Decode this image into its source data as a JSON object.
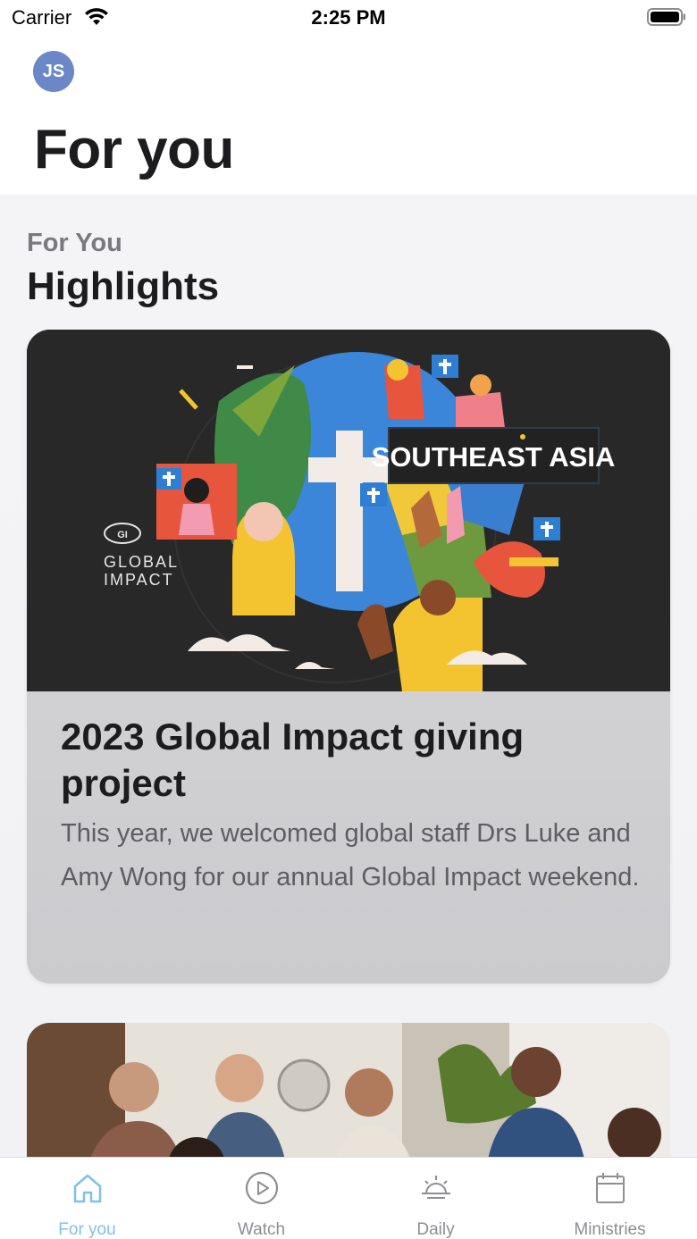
{
  "status_bar": {
    "carrier": "Carrier",
    "time": "2:25 PM",
    "wifi_icon": "wifi-icon",
    "battery_icon": "battery-icon"
  },
  "header": {
    "avatar_initials": "JS",
    "title": "For you"
  },
  "section": {
    "kicker": "For You",
    "title": "Highlights"
  },
  "cards": [
    {
      "image_text": "SOUTHEAST ASIA",
      "logo_mark": "GI",
      "logo_text_1": "GLOBAL",
      "logo_text_2": "IMPACT",
      "title": "2023 Global Impact giving project",
      "description": "This year, we welcomed global staff Drs Luke and Amy Wong for our annual Global Impact weekend."
    },
    {
      "image": "group-photo"
    }
  ],
  "tabs": [
    {
      "label": "For you",
      "icon": "home-icon",
      "active": true
    },
    {
      "label": "Watch",
      "icon": "play-circle-icon",
      "active": false
    },
    {
      "label": "Daily",
      "icon": "sunrise-icon",
      "active": false
    },
    {
      "label": "Ministries",
      "icon": "calendar-icon",
      "active": false
    }
  ],
  "colors": {
    "accent": "#7fc1e8",
    "avatar": "#6b87c7",
    "inactive_tab": "#8e8e93"
  }
}
